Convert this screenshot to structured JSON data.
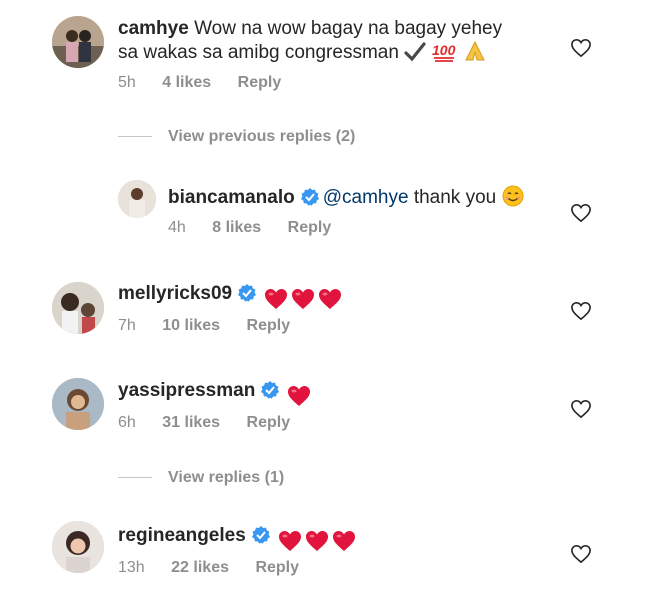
{
  "comments": [
    {
      "username": "camhye",
      "text_line1": "Wow na wow bagay na bagay yehey",
      "text_line2": "sa wakas sa amibg congressman",
      "time": "5h",
      "likes": "4 likes",
      "reply": "Reply"
    },
    {
      "username": "biancamanalo",
      "mention": "@camhye",
      "text": "thank you",
      "time": "4h",
      "likes": "8 likes",
      "reply": "Reply"
    },
    {
      "username": "mellyricks09",
      "time": "7h",
      "likes": "10 likes",
      "reply": "Reply"
    },
    {
      "username": "yassipressman",
      "time": "6h",
      "likes": "31 likes",
      "reply": "Reply"
    },
    {
      "username": "regineangeles",
      "time": "13h",
      "likes": "22 likes",
      "reply": "Reply"
    }
  ],
  "view_previous_replies": "View previous replies (2)",
  "view_replies": "View replies (1)",
  "colors": {
    "text": "#262626",
    "meta": "#8e8e8e",
    "mention": "#00376b",
    "verified": "#3897f0",
    "heart_emoji": "#e0143c"
  },
  "icons": [
    "verified-badge-icon",
    "heart-emoji-icon",
    "check-emoji-icon",
    "hundred-emoji-icon",
    "folded-hands-emoji-icon",
    "smile-emoji-icon",
    "like-heart-outline-icon"
  ]
}
